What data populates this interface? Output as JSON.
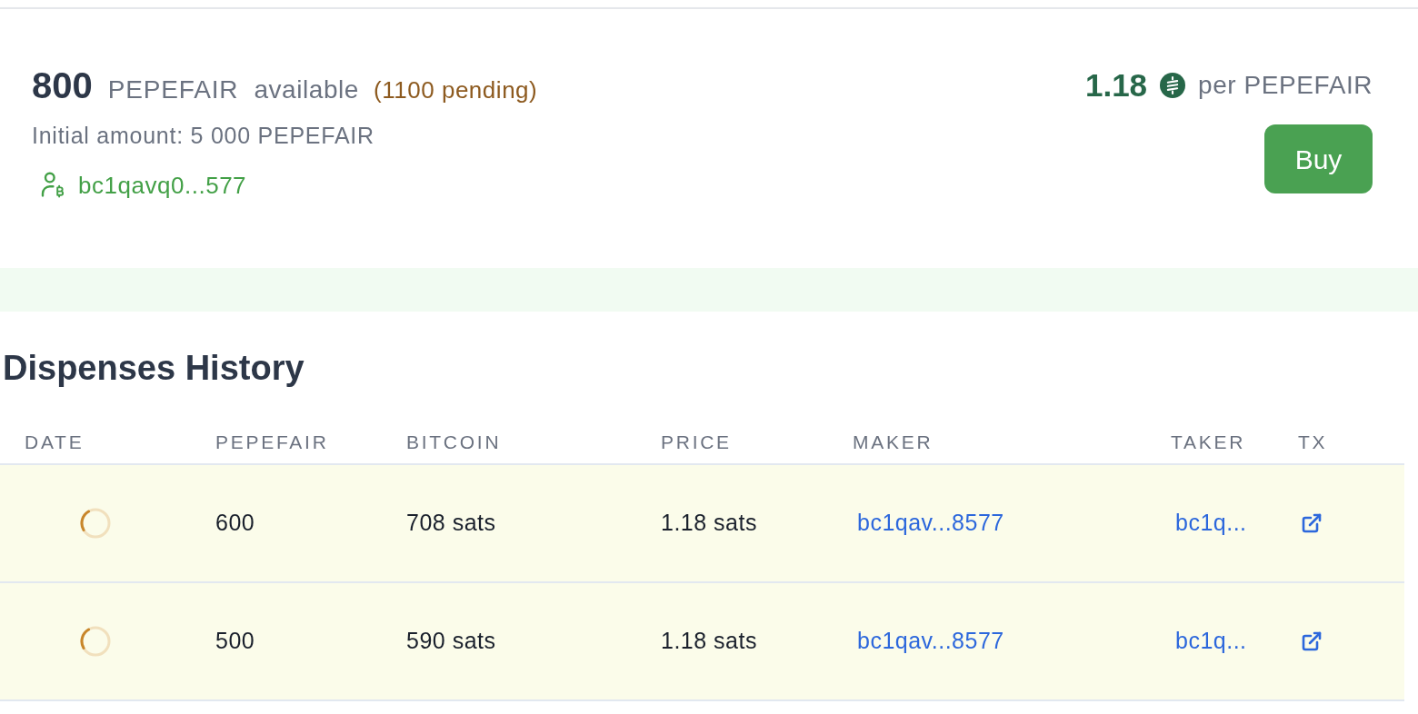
{
  "offer": {
    "amount": "800",
    "asset": "PEPEFAIR",
    "status": "available",
    "pending": "(1100 pending)",
    "initial_amount": "Initial amount: 5 000 PEPEFAIR",
    "seller": "bc1qavq0...577",
    "price": "1.18",
    "price_unit": "per PEPEFAIR",
    "button": "Buy"
  },
  "history": {
    "title": "Dispenses History",
    "columns": [
      "DATE",
      "PEPEFAIR",
      "BITCOIN",
      "PRICE",
      "MAKER",
      "TAKER",
      "TX"
    ],
    "rows": [
      {
        "pending": true,
        "amount": "600",
        "bitcoin": "708 sats",
        "price": "1.18 sats",
        "maker": "bc1qav...8577",
        "taker": "bc1q..."
      },
      {
        "pending": true,
        "amount": "500",
        "bitcoin": "590 sats",
        "price": "1.18 sats",
        "maker": "bc1qav...8577",
        "taker": "bc1q..."
      }
    ]
  }
}
